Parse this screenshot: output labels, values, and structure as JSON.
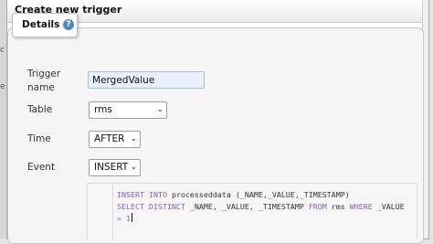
{
  "dialog": {
    "title": "Create new trigger"
  },
  "details": {
    "legend": "Details",
    "help_icon": "?"
  },
  "background": {
    "glyph1": "c",
    "glyph2": "e"
  },
  "form": {
    "trigger_name_label": "Trigger name",
    "trigger_name_value": "MergedValue",
    "table_label": "Table",
    "table_value": "rms",
    "time_label": "Time",
    "time_value": "AFTER",
    "event_label": "Event",
    "event_value": "INSERT"
  },
  "code": {
    "line1": {
      "kw1": "INSERT INTO",
      "rest": " processeddata (_NAME,_VALUE,_TIMESTAMP)"
    },
    "line2": {
      "kw1": "SELECT DISTINCT",
      "mid1": " _NAME, _VALUE, _TIMESTAMP ",
      "kw2": "FROM",
      "mid2": " rms ",
      "kw3": "WHERE",
      "rest": " _VALUE"
    },
    "line3": {
      "text": "= 1"
    }
  },
  "icons": {
    "chevron": "chevron-down-icon",
    "help": "help-icon"
  },
  "colors": {
    "input_bg": "#e8f0fc",
    "keyword": "#8b5cc7",
    "help_icon": "#4a88c7"
  }
}
